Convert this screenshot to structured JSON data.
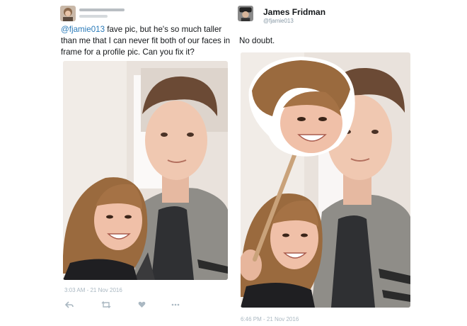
{
  "left_tweet": {
    "mention": "@fjamie013",
    "text": " fave pic, but he's so much taller than me that I can never fit both of our faces in frame for a profile pic. Can you fix it?",
    "timestamp": "3:03 AM - 21 Nov 2016",
    "actions": [
      "reply-icon",
      "retweet-icon",
      "like-icon",
      "more-icon"
    ]
  },
  "right_tweet": {
    "name": "James Fridman",
    "handle": "@fjamie013",
    "text": "No doubt.",
    "timestamp": "6:46 PM - 21 Nov 2016"
  },
  "colors": {
    "link": "#2b7bb9",
    "muted": "#aab8c2",
    "text": "#14171a"
  }
}
